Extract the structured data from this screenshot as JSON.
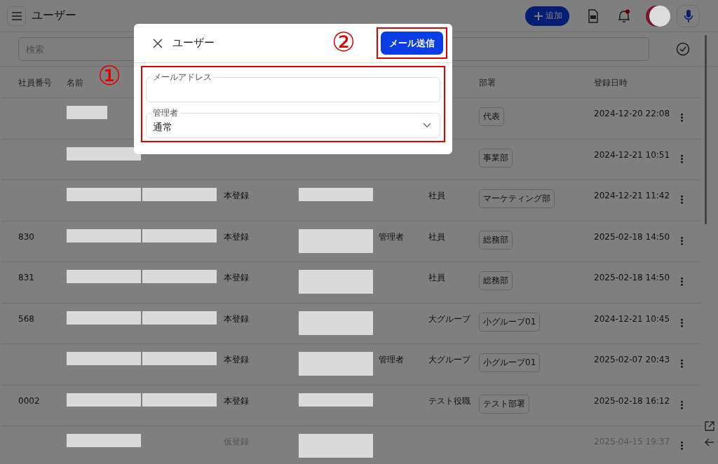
{
  "app_bar": {
    "title": "ユーザー",
    "add_button": "追加"
  },
  "search": {
    "placeholder": "検索"
  },
  "table": {
    "columns": [
      {
        "kind": "label",
        "label": "社員番号"
      },
      {
        "kind": "label",
        "label": "名前"
      },
      {
        "kind": "hidden"
      },
      {
        "kind": "hidden"
      },
      {
        "kind": "hidden"
      },
      {
        "kind": "hidden"
      },
      {
        "kind": "hidden"
      },
      {
        "kind": "label",
        "label": "部署"
      },
      {
        "kind": "label",
        "label": "登録日時"
      }
    ],
    "rows": [
      {
        "provisional": false,
        "cells": [
          {
            "kind": "blank"
          },
          {
            "kind": "redacted-short"
          },
          {
            "kind": "blank"
          },
          {
            "kind": "blank"
          },
          {
            "kind": "blank"
          },
          {
            "kind": "blank"
          },
          {
            "kind": "blank"
          },
          {
            "kind": "tag",
            "text": "代表"
          },
          {
            "kind": "text",
            "text": "2024-12-20 22:08"
          }
        ]
      },
      {
        "provisional": false,
        "cells": [
          {
            "kind": "blank"
          },
          {
            "kind": "redacted"
          },
          {
            "kind": "blank"
          },
          {
            "kind": "blank"
          },
          {
            "kind": "blank"
          },
          {
            "kind": "blank"
          },
          {
            "kind": "blank"
          },
          {
            "kind": "tag",
            "text": "事業部"
          },
          {
            "kind": "text",
            "text": "2024-12-21 10:51"
          }
        ]
      },
      {
        "provisional": false,
        "cells": [
          {
            "kind": "blank"
          },
          {
            "kind": "redacted"
          },
          {
            "kind": "redacted"
          },
          {
            "kind": "text",
            "text": "本登録"
          },
          {
            "kind": "redacted"
          },
          {
            "kind": "blank"
          },
          {
            "kind": "text",
            "text": "社員"
          },
          {
            "kind": "tag",
            "text": "マーケティング部"
          },
          {
            "kind": "text",
            "text": "2024-12-21 11:42"
          }
        ]
      },
      {
        "provisional": false,
        "cells": [
          {
            "kind": "text",
            "text": "830"
          },
          {
            "kind": "redacted"
          },
          {
            "kind": "redacted"
          },
          {
            "kind": "text",
            "text": "本登録"
          },
          {
            "kind": "redacted-tall"
          },
          {
            "kind": "text",
            "text": "管理者"
          },
          {
            "kind": "text",
            "text": "社員"
          },
          {
            "kind": "tag",
            "text": "総務部"
          },
          {
            "kind": "text",
            "text": "2025-02-18 14:50"
          }
        ]
      },
      {
        "provisional": false,
        "cells": [
          {
            "kind": "text",
            "text": "831"
          },
          {
            "kind": "redacted"
          },
          {
            "kind": "redacted"
          },
          {
            "kind": "text",
            "text": "本登録"
          },
          {
            "kind": "redacted-tall"
          },
          {
            "kind": "blank"
          },
          {
            "kind": "text",
            "text": "社員"
          },
          {
            "kind": "tag",
            "text": "総務部"
          },
          {
            "kind": "text",
            "text": "2025-02-18 14:50"
          }
        ]
      },
      {
        "provisional": false,
        "cells": [
          {
            "kind": "text",
            "text": "568"
          },
          {
            "kind": "redacted"
          },
          {
            "kind": "redacted"
          },
          {
            "kind": "text",
            "text": "本登録"
          },
          {
            "kind": "redacted-tall"
          },
          {
            "kind": "blank"
          },
          {
            "kind": "text",
            "text": "大グループ"
          },
          {
            "kind": "tag",
            "text": "小グループ01"
          },
          {
            "kind": "text",
            "text": "2024-12-21 10:45"
          }
        ]
      },
      {
        "provisional": false,
        "cells": [
          {
            "kind": "blank"
          },
          {
            "kind": "redacted"
          },
          {
            "kind": "redacted"
          },
          {
            "kind": "text",
            "text": "本登録"
          },
          {
            "kind": "redacted-tall"
          },
          {
            "kind": "text",
            "text": "管理者"
          },
          {
            "kind": "text",
            "text": "大グループ"
          },
          {
            "kind": "tag",
            "text": "小グループ01"
          },
          {
            "kind": "text",
            "text": "2025-02-07 20:43"
          }
        ]
      },
      {
        "provisional": false,
        "cells": [
          {
            "kind": "text",
            "text": "0002"
          },
          {
            "kind": "redacted"
          },
          {
            "kind": "redacted"
          },
          {
            "kind": "text",
            "text": "本登録"
          },
          {
            "kind": "redacted"
          },
          {
            "kind": "blank"
          },
          {
            "kind": "text",
            "text": "テスト役職"
          },
          {
            "kind": "tag",
            "text": "テスト部署"
          },
          {
            "kind": "text",
            "text": "2025-02-18 16:12"
          }
        ]
      },
      {
        "provisional": true,
        "cells": [
          {
            "kind": "blank"
          },
          {
            "kind": "redacted"
          },
          {
            "kind": "blank"
          },
          {
            "kind": "text",
            "text": "仮登録"
          },
          {
            "kind": "redacted-tall"
          },
          {
            "kind": "blank"
          },
          {
            "kind": "blank"
          },
          {
            "kind": "blank"
          },
          {
            "kind": "text",
            "text": "2025-04-15 19:37"
          }
        ]
      }
    ]
  },
  "dialog": {
    "title": "ユーザー",
    "send_button": "メール送信",
    "send_annotation": "②",
    "form_annotation": "①",
    "fields": [
      {
        "kind": "text",
        "label": "メールアドレス"
      },
      {
        "kind": "select",
        "label": "管理者",
        "value": "通常"
      }
    ]
  }
}
